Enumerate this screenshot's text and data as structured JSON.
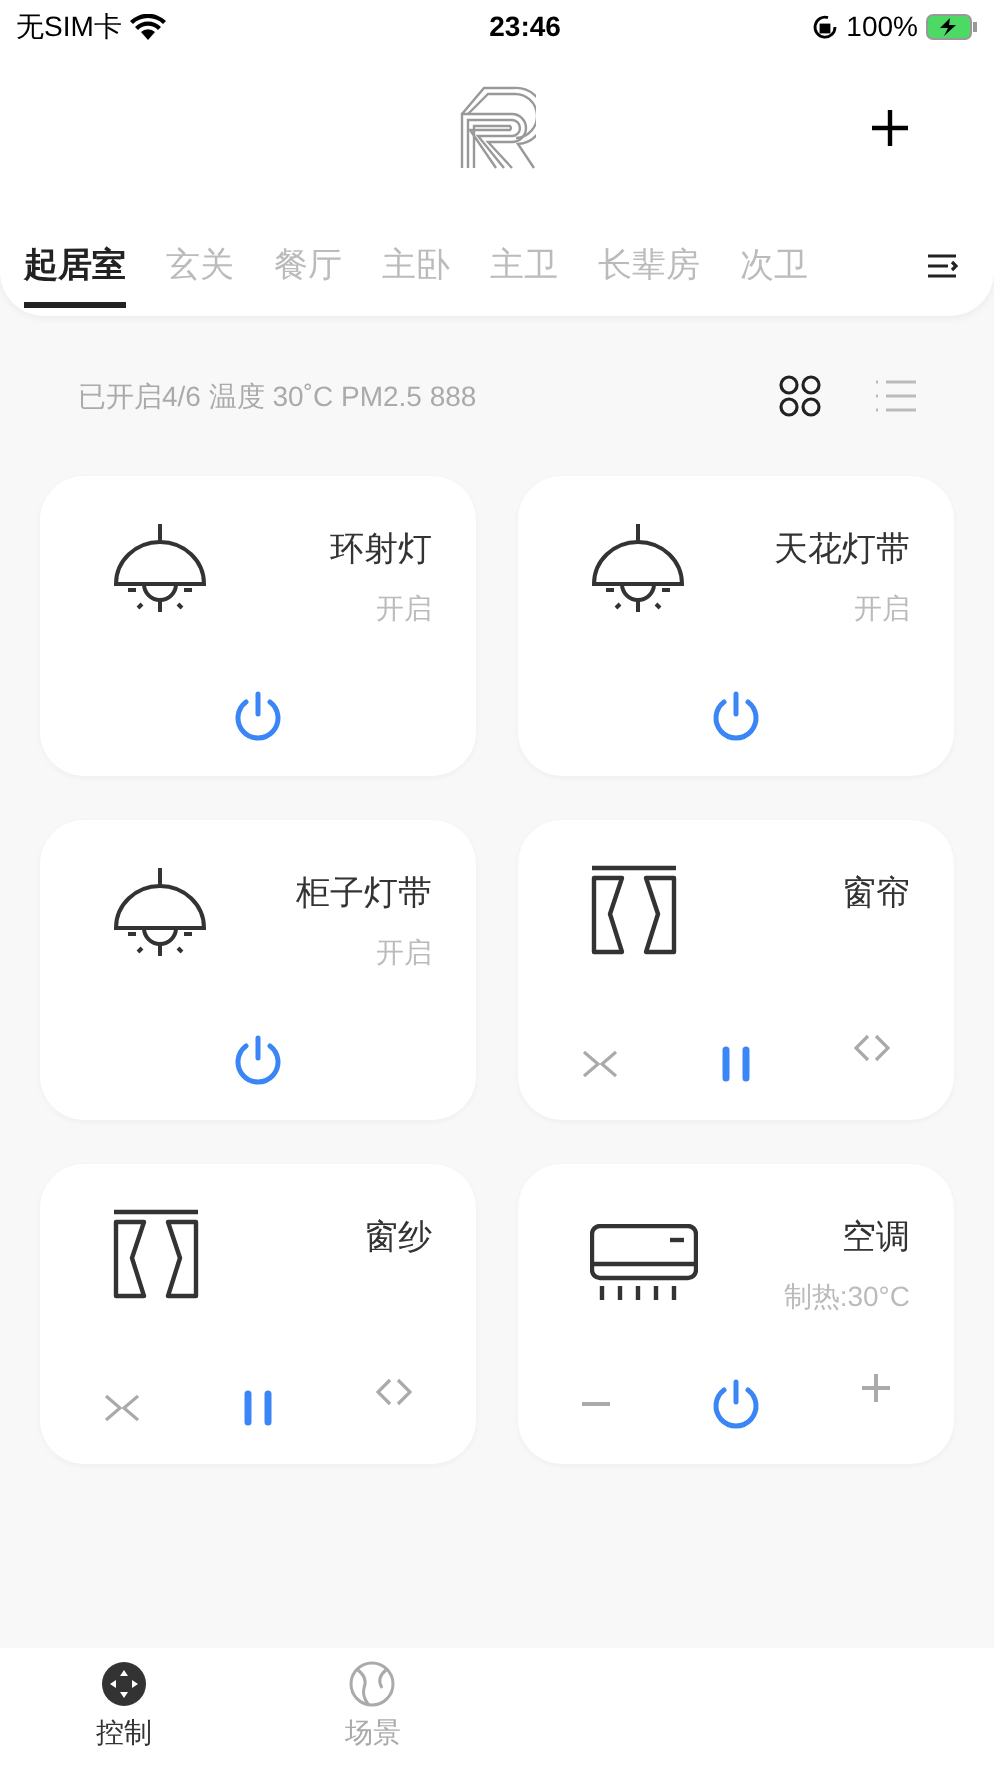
{
  "status_bar": {
    "carrier": "无SIM卡",
    "time": "23:46",
    "battery": "100%"
  },
  "rooms": [
    {
      "label": "起居室",
      "selected": true
    },
    {
      "label": "玄关",
      "selected": false
    },
    {
      "label": "餐厅",
      "selected": false
    },
    {
      "label": "主卧",
      "selected": false
    },
    {
      "label": "主卫",
      "selected": false
    },
    {
      "label": "长辈房",
      "selected": false
    },
    {
      "label": "次卫",
      "selected": false
    }
  ],
  "summary": "已开启4/6 温度 30˚C PM2.5 888",
  "view_modes": [
    {
      "kind": "grid",
      "selected": true
    },
    {
      "kind": "list",
      "selected": false
    }
  ],
  "devices": [
    {
      "kind": "light",
      "name": "环射灯",
      "status": "开启",
      "on": true
    },
    {
      "kind": "light",
      "name": "天花灯带",
      "status": "开启",
      "on": true
    },
    {
      "kind": "light",
      "name": "柜子灯带",
      "status": "开启",
      "on": true
    },
    {
      "kind": "curtain",
      "name": "窗帘",
      "paused": true
    },
    {
      "kind": "curtain",
      "name": "窗纱",
      "paused": true
    },
    {
      "kind": "ac",
      "name": "空调",
      "status": "制热:30°C",
      "on": true
    }
  ],
  "bottom_tabs": [
    {
      "kind": "control",
      "label": "控制",
      "selected": true
    },
    {
      "kind": "scene",
      "label": "场景",
      "selected": false
    }
  ]
}
